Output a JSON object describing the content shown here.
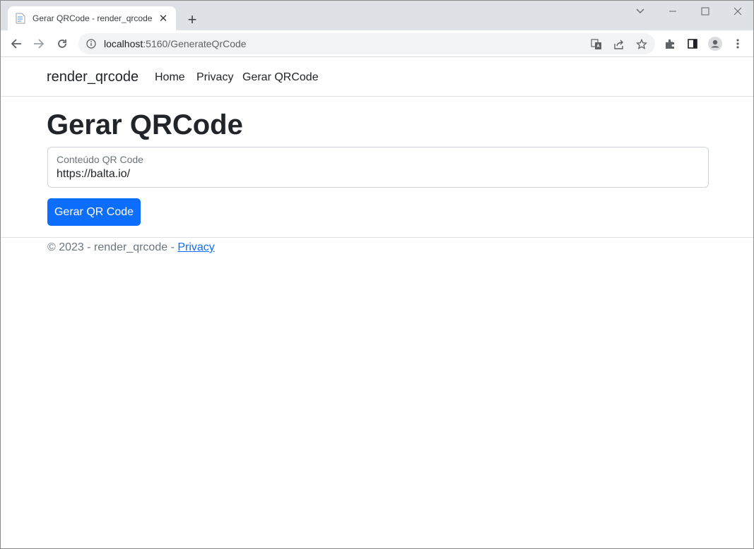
{
  "browser": {
    "tab_title": "Gerar QRCode - render_qrcode",
    "url_host": "localhost",
    "url_path": ":5160/GenerateQrCode",
    "accent": "#0d6efd"
  },
  "navbar": {
    "brand": "render_qrcode",
    "links": [
      "Home",
      "Privacy",
      "Gerar QRCode"
    ]
  },
  "main": {
    "title": "Gerar QRCode",
    "field_label": "Conteúdo QR Code",
    "field_value": "https://balta.io/",
    "button_label": "Gerar QR Code"
  },
  "footer": {
    "text": "© 2023 - render_qrcode - ",
    "link": "Privacy"
  }
}
